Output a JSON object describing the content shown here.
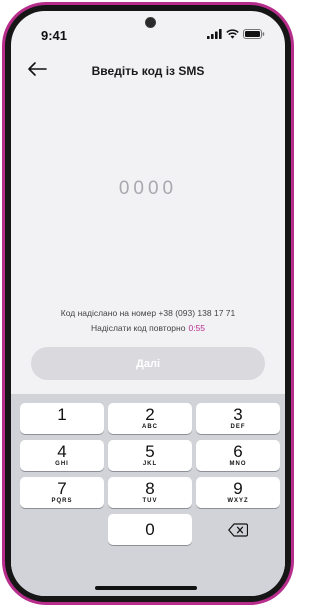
{
  "status_bar": {
    "time": "9:41"
  },
  "header": {
    "title": "Введіть код із SMS"
  },
  "code": {
    "placeholder": "0000"
  },
  "info": {
    "sent_text": "Код надіслано на  номер +38 (093) 138 17 71",
    "resend_text": "Надіслати код повторно",
    "timer": "0:55"
  },
  "next_button": {
    "label": "Далі"
  },
  "keypad": {
    "keys": [
      {
        "num": "1",
        "letters": ""
      },
      {
        "num": "2",
        "letters": "ABC"
      },
      {
        "num": "3",
        "letters": "DEF"
      },
      {
        "num": "4",
        "letters": "GHI"
      },
      {
        "num": "5",
        "letters": "JKL"
      },
      {
        "num": "6",
        "letters": "MNO"
      },
      {
        "num": "7",
        "letters": "PQRS"
      },
      {
        "num": "8",
        "letters": "TUV"
      },
      {
        "num": "9",
        "letters": "WXYZ"
      },
      {
        "num": "0",
        "letters": ""
      }
    ]
  },
  "colors": {
    "accent": "#b72d8c",
    "button_disabled": "#d9d9de",
    "keyboard_bg": "#d1d3d9"
  }
}
